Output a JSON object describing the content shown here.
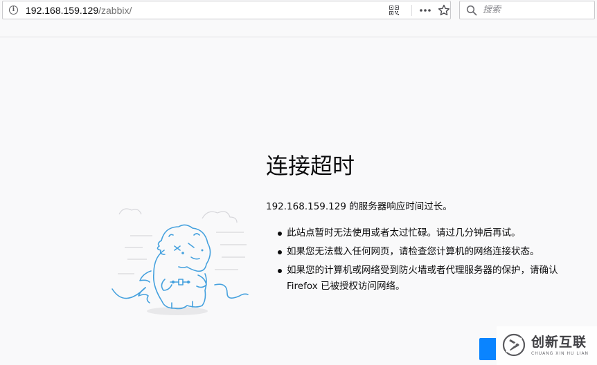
{
  "browser": {
    "url_host": "192.168.159.129",
    "url_path": "/zabbix/",
    "search_placeholder": "搜索"
  },
  "error_page": {
    "title": "连接超时",
    "description": "192.168.159.129 的服务器响应时间过长。",
    "tips": [
      "此站点暂时无法使用或者太过忙碌。请过几分钟后再试。",
      "如果您无法载入任何网页，请检查您计算机的网络连接状态。",
      "如果您的计算机或网络受到防火墙或者代理服务器的保护，请确认 Firefox 已被授权访问网络。"
    ]
  },
  "watermark": {
    "brand": "创新互联",
    "sub": "CHUANG XIN HU LIAN"
  },
  "colors": {
    "accent": "#0a84ff",
    "illustration_blue": "#45a1de",
    "page_background": "#f9f9fa"
  },
  "icons": [
    "info-icon",
    "qr-code-icon",
    "more-actions-icon",
    "bookmark-star-icon",
    "search-icon",
    "disconnected-dinosaur-illustration"
  ]
}
